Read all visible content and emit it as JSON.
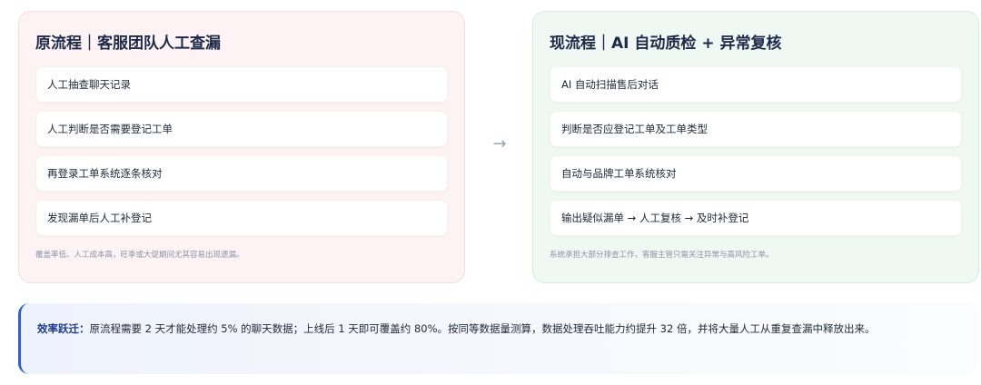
{
  "old_flow": {
    "title": "原流程｜客服团队人工查漏",
    "steps": [
      "人工抽查聊天记录",
      "人工判断是否需要登记工单",
      "再登录工单系统逐条核对",
      "发现漏单后人工补登记"
    ],
    "note": "覆盖率低、人工成本高，旺季或大促期间尤其容易出现遗漏。"
  },
  "arrow": "→",
  "new_flow": {
    "title": "现流程｜AI 自动质检 + 异常复核",
    "steps": [
      "AI 自动扫描售后对话",
      "判断是否应登记工单及工单类型",
      "自动与品牌工单系统核对",
      "输出疑似漏单 → 人工复核 → 及时补登记"
    ],
    "note": "系统承担大部分排查工作，客服主管只需关注异常与高风险工单。"
  },
  "summary": {
    "label": "效率跃迁：",
    "text": "原流程需要 2 天才能处理约 5% 的聊天数据；上线后 1 天即可覆盖约 80%。按同等数据量测算，数据处理吞吐能力约提升 32 倍，并将大量人工从重复查漏中释放出来。"
  },
  "colors": {
    "old_panel_bg": "#fdf3f4",
    "new_panel_bg": "#eff8f3",
    "accent": "#2f5fd0"
  }
}
